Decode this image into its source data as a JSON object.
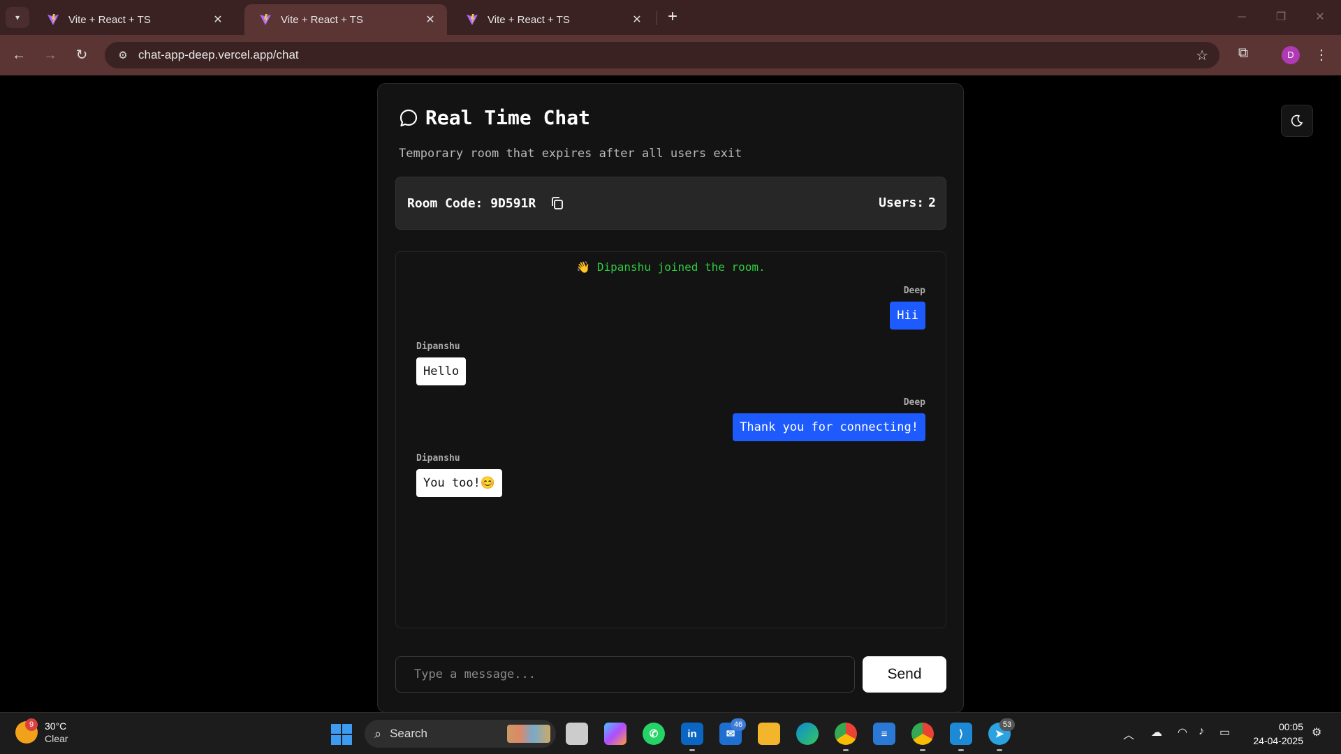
{
  "browser": {
    "tabs": [
      {
        "title": "Vite + React + TS",
        "active": false
      },
      {
        "title": "Vite + React + TS",
        "active": true
      },
      {
        "title": "Vite + React + TS",
        "active": false
      }
    ],
    "url": "chat-app-deep.vercel.app/chat",
    "profile_initial": "D"
  },
  "chat": {
    "title": "Real Time Chat",
    "subtitle": "Temporary room that expires after all users exit",
    "room_code_label": "Room Code: 9D591R",
    "users_label": "Users:",
    "users_count": "2",
    "system_message": "👋 Dipanshu joined the room.",
    "messages": [
      {
        "sender": "Deep",
        "text": "Hii",
        "side": "right"
      },
      {
        "sender": "Dipanshu",
        "text": "Hello",
        "side": "left"
      },
      {
        "sender": "Deep",
        "text": "Thank you for connecting!",
        "side": "right"
      },
      {
        "sender": "Dipanshu",
        "text": "You too!😊",
        "side": "left"
      }
    ],
    "input_placeholder": "Type a message...",
    "send_label": "Send"
  },
  "taskbar": {
    "weather_badge": "9",
    "temperature": "30°C",
    "condition": "Clear",
    "search_label": "Search",
    "mail_badge": "46",
    "telegram_badge": "53",
    "time": "00:05",
    "date": "24-04-2025"
  },
  "colors": {
    "accent_blue": "#1d5bff",
    "system_green": "#2ecc40",
    "browser_frame": "#5b3434"
  }
}
